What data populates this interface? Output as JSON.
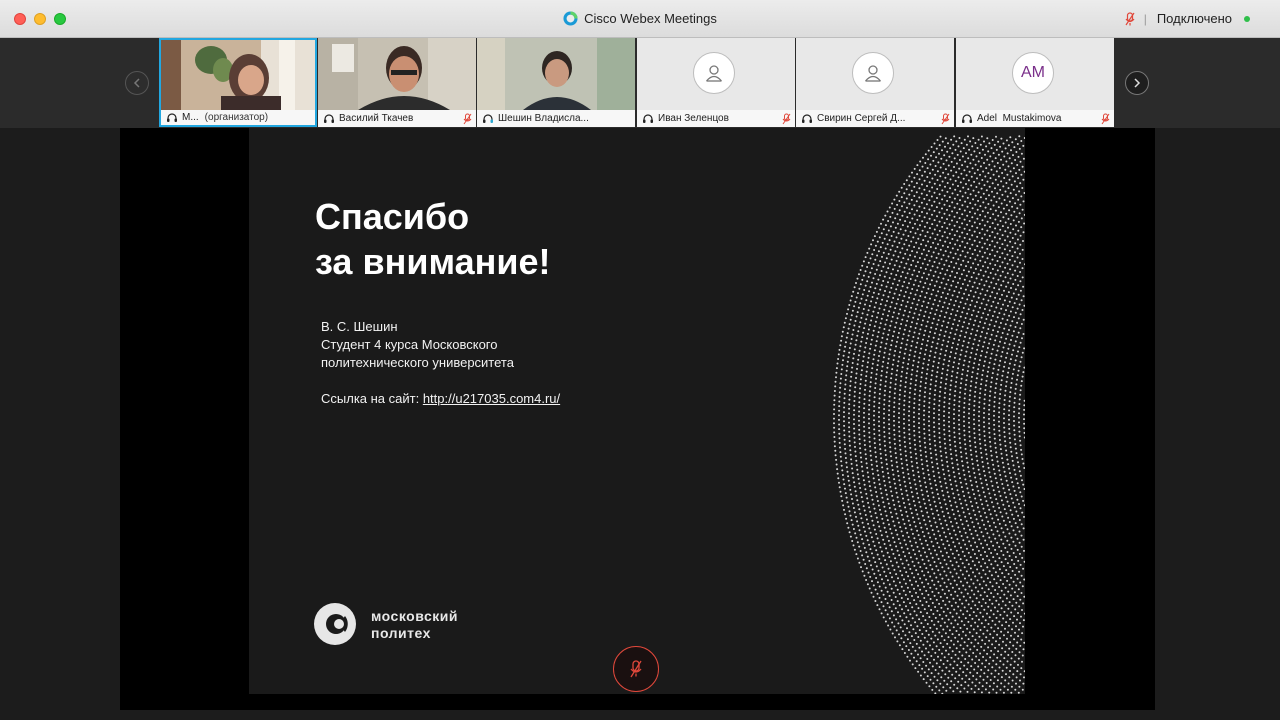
{
  "window": {
    "title": "Cisco Webex Meetings",
    "connection_status": "Подключено"
  },
  "participants": [
    {
      "name": "М...",
      "role": "(организатор)",
      "video": true,
      "active": true,
      "muted": false
    },
    {
      "name": "Василий Ткачев",
      "video": true,
      "active": false,
      "muted": true
    },
    {
      "name": "Шешин Владисла...",
      "video": true,
      "active": false,
      "muted": false
    },
    {
      "name": "Иван Зеленцов",
      "video": false,
      "avatar": "person-icon",
      "muted": true
    },
    {
      "name": "Свирин Сергей Д...",
      "video": false,
      "avatar": "person-icon",
      "muted": true
    },
    {
      "name": "Adel  Mustakimova",
      "video": false,
      "avatar_initials": "AM",
      "muted": true
    }
  ],
  "slide": {
    "title_line1": "Спасибо",
    "title_line2": "за внимание!",
    "author": "В. С. Шешин",
    "position_line1": "Студент 4 курса Московского",
    "position_line2": "политехнического университета",
    "site_label": "Ссылка на сайт: ",
    "site_url": "http://u217035.com4.ru/",
    "logo_line1": "московский",
    "logo_line2": "политех"
  },
  "colors": {
    "accent": "#22a7e0",
    "mute_red": "#e0483b",
    "status_green": "#2fbf4a"
  }
}
